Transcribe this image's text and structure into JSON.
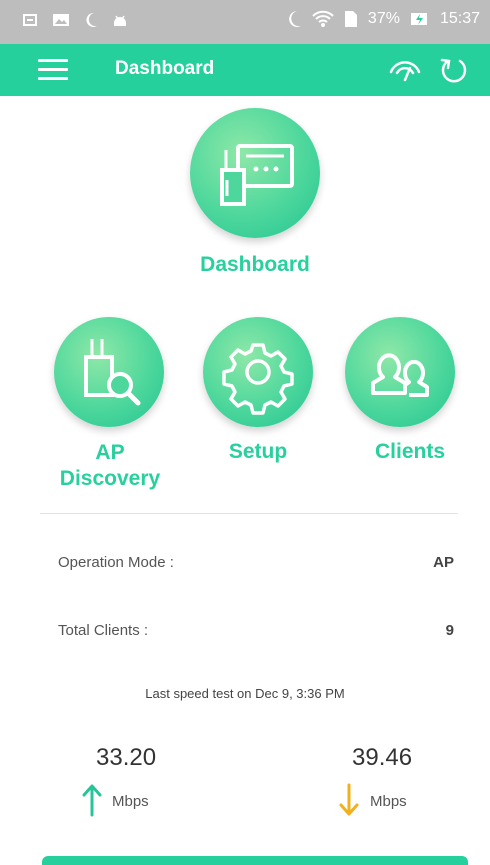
{
  "status": {
    "battery": "37%",
    "time": "15:37"
  },
  "appbar": {
    "title": "Dashboard"
  },
  "nav": {
    "dashboard": "Dashboard",
    "ap_discovery_line1": "AP",
    "ap_discovery_line2": "Discovery",
    "setup": "Setup",
    "clients": "Clients"
  },
  "info": {
    "operation_mode_label": "Operation Mode :",
    "operation_mode_value": "AP",
    "total_clients_label": "Total Clients :",
    "total_clients_value": "9"
  },
  "speed": {
    "note": "Last speed test on Dec 9, 3:36 PM",
    "upload_value": "33.20",
    "upload_unit": "Mbps",
    "download_value": "39.46",
    "download_unit": "Mbps"
  },
  "colors": {
    "accent": "#26d09c",
    "upload_arrow": "#27c49a",
    "download_arrow": "#f2b01e"
  }
}
